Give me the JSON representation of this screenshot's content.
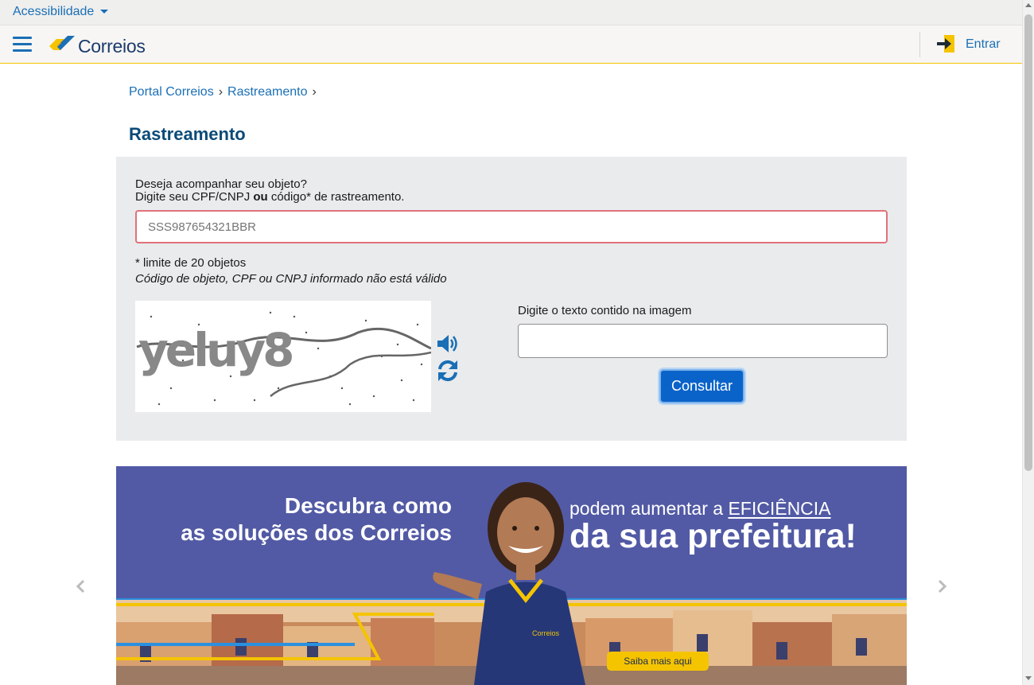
{
  "topbar": {
    "accessibility_label": "Acessibilidade"
  },
  "header": {
    "brand": "Correios",
    "login_label": "Entrar"
  },
  "breadcrumb": {
    "items": [
      "Portal Correios",
      "Rastreamento"
    ]
  },
  "page": {
    "title": "Rastreamento"
  },
  "form": {
    "prompt_line1": "Deseja acompanhar seu objeto?",
    "prompt_line2_pre": "Digite seu CPF/CNPJ ",
    "prompt_line2_bold": "ou",
    "prompt_line2_post": " código* de rastreamento.",
    "code_placeholder": "SSS987654321BBR",
    "limit_note": "* limite de 20 objetos",
    "error_message": "Código de objeto, CPF ou CNPJ informado não está válido",
    "captcha_label": "Digite o texto contido na imagem",
    "captcha_text": "yeluy8",
    "submit_label": "Consultar",
    "error_color": "#e0727a",
    "button_color": "#0a63c9"
  },
  "banner": {
    "left_line1": "Descubra como",
    "left_line2": "as soluções dos Correios",
    "right_line1_pre": "podem aumentar a ",
    "right_line1_underlined": "EFICIÊNCIA",
    "right_line2": "da sua prefeitura!",
    "cta_label": "Saiba mais aqui",
    "uniform_logo": "Correios",
    "background_color": "#525aa5"
  },
  "colors": {
    "link": "#1a6fb5",
    "title": "#0b4a78",
    "brand_yellow": "#f5c400",
    "panel_bg": "#e9ebed"
  }
}
